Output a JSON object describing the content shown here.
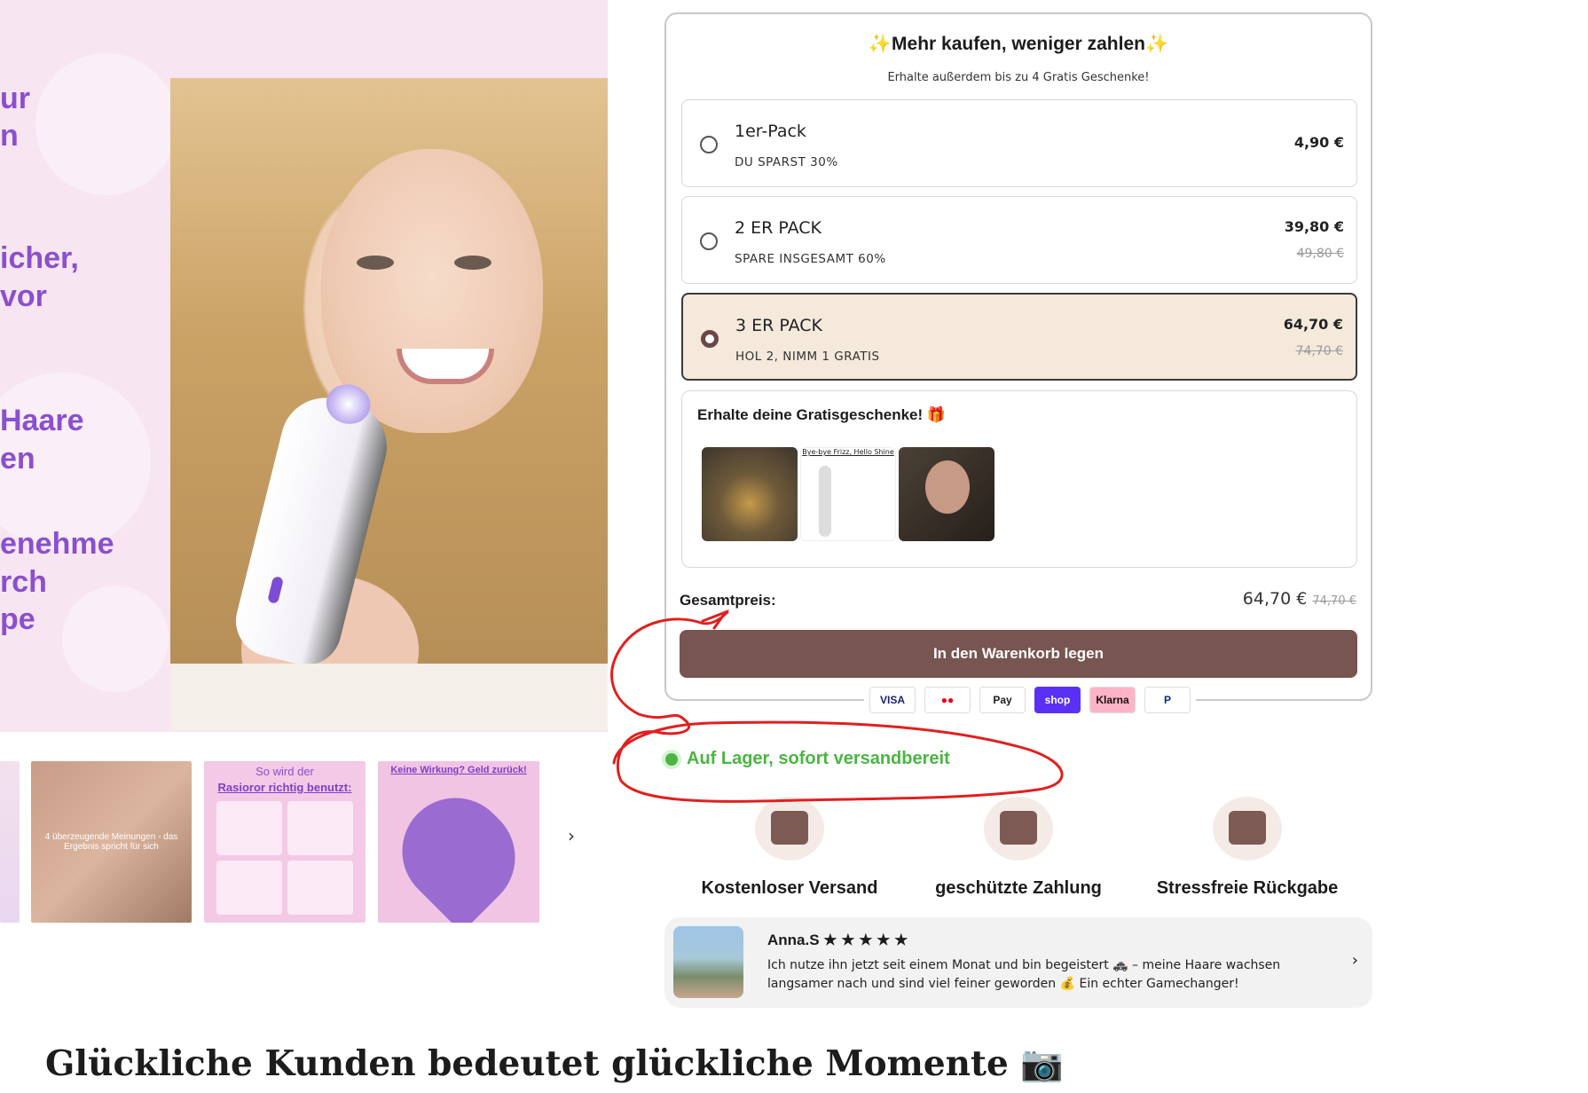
{
  "hero": {
    "heading_fragments": [
      "ur",
      "n",
      "icher,",
      "vor",
      " Haare",
      "en",
      "enehme",
      "rch",
      "pe"
    ]
  },
  "thumbnails": {
    "items": [
      {
        "caption": ""
      },
      {
        "caption": "4 überzeugende Meinungen - das Ergebnis spricht für sich"
      },
      {
        "title1": "So wird der",
        "title2": "Rasioror richtig benutzt:"
      },
      {
        "title": "Keine Wirkung? Geld zurück!"
      }
    ],
    "next_label": "›"
  },
  "bundle": {
    "title": "Mehr kaufen, weniger zahlen",
    "subtitle": "Erhalte außerdem bis zu 4 Gratis Geschenke!",
    "options": [
      {
        "name": "1er-Pack",
        "desc": "DU SPARST 30%",
        "price": "4,90 €",
        "old_price": "",
        "selected": false
      },
      {
        "name": "2 ER PACK",
        "desc": "SPARE INSGESAMT 60%",
        "price": "39,80 €",
        "old_price": "49,80 €",
        "selected": false
      },
      {
        "name": "3 ER PACK",
        "desc": "HOL 2, NIMM 1 GRATIS",
        "price": "64,70 €",
        "old_price": "74,70 €",
        "selected": true
      }
    ],
    "gifts": {
      "title": "Erhalte deine Gratisgeschenke! 🎁",
      "gift2_caption": "Bye-bye Frizz, Hello Shine"
    },
    "total_label": "Gesamtpreis:",
    "total_price": "64,70 €",
    "total_old_price": "74,70 €",
    "add_to_cart": "In den Warenkorb legen"
  },
  "payments": [
    "VISA",
    "●●",
    "Pay",
    "shop",
    "Klarna",
    "P"
  ],
  "stock": {
    "text": "Auf Lager, sofort versandbereit",
    "color": "#4bb543"
  },
  "features": [
    {
      "icon": "truck-icon",
      "label": "Kostenloser Versand"
    },
    {
      "icon": "shield-card-icon",
      "label": "geschützte Zahlung"
    },
    {
      "icon": "return-bag-icon",
      "label": "Stressfreie Rückgabe"
    }
  ],
  "review": {
    "name": "Anna.S ★ ★ ★ ★ ★",
    "text": "Ich nutze ihn jetzt seit einem Monat und bin begeistert 🚓 – meine Haare wachsen langsamer nach und sind viel feiner geworden 💰 Ein echter Gamechanger!",
    "next_label": "›"
  },
  "bottom_heading": "Glückliche Kunden bedeutet glückliche Momente 📷",
  "colors": {
    "accent": "#775550",
    "hero_purple": "#8b4fcf",
    "selected_bg": "#f5e9dc",
    "annotation_red": "#e02020"
  }
}
